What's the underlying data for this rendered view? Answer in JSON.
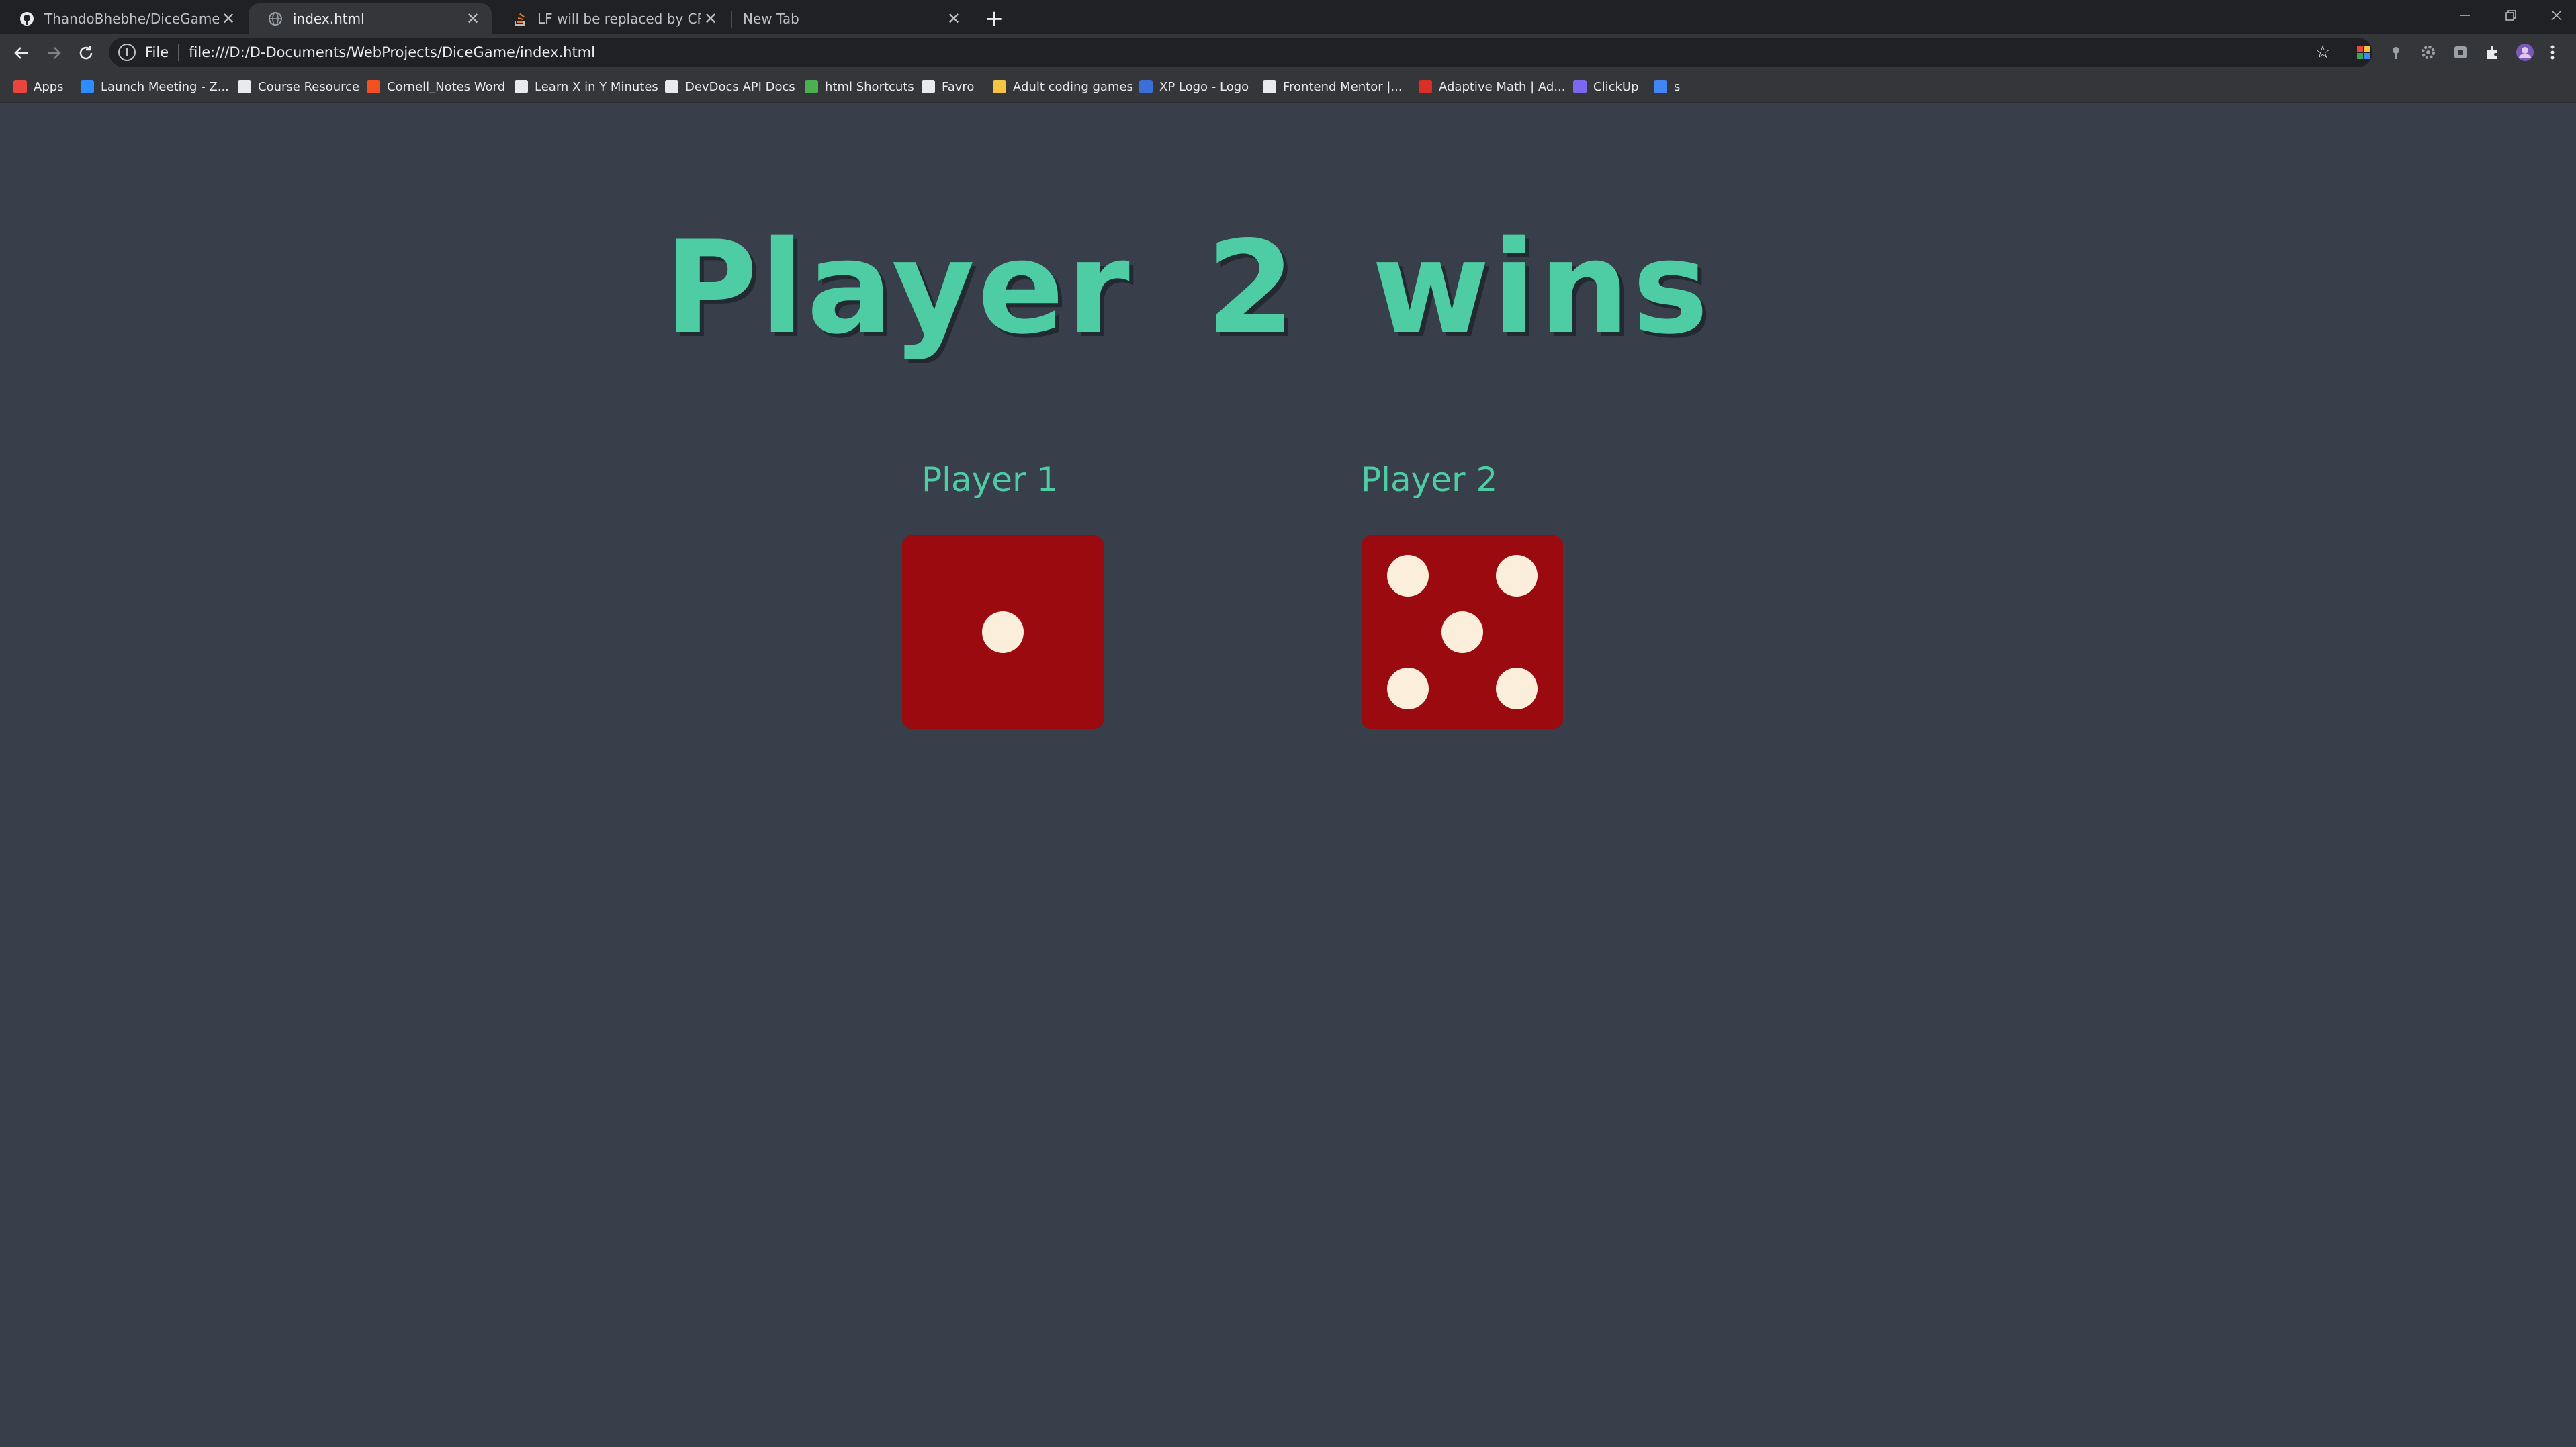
{
  "browser": {
    "tabs": [
      {
        "title": "ThandoBhebhe/DiceGame: Small",
        "favicon": "github-icon",
        "active": false
      },
      {
        "title": "index.html",
        "favicon": "globe-icon",
        "active": true
      },
      {
        "title": "LF will be replaced by CRLF in git",
        "favicon": "stackoverflow-icon",
        "active": false
      },
      {
        "title": "New Tab",
        "favicon": "",
        "active": false
      }
    ],
    "address": {
      "scheme_label": "File",
      "url": "file:///D:/D-Documents/WebProjects/DiceGame/index.html"
    },
    "bookmarks": [
      {
        "label": "Apps",
        "icon": "apps-grid-icon",
        "color": "#e8453c"
      },
      {
        "label": "Launch Meeting - Z...",
        "icon": "zoom-icon",
        "color": "#2d8cff"
      },
      {
        "label": "Course Resource",
        "icon": "course-icon",
        "color": "#e8eaed"
      },
      {
        "label": "Cornell_Notes Word",
        "icon": "microsoft-icon",
        "color": "#f25022"
      },
      {
        "label": "Learn X in Y Minutes",
        "icon": "x-icon",
        "color": "#e8eaed"
      },
      {
        "label": "DevDocs API Docs",
        "icon": "devdocs-icon",
        "color": "#e8eaed"
      },
      {
        "label": "html Shortcuts",
        "icon": "html-icon",
        "color": "#4caf50"
      },
      {
        "label": "Favro",
        "icon": "favro-icon",
        "color": "#e8eaed"
      },
      {
        "label": "Adult coding games",
        "icon": "folder-icon",
        "color": "#f4c542"
      },
      {
        "label": "XP Logo - Logo",
        "icon": "xp-logo-icon",
        "color": "#3b6fd8"
      },
      {
        "label": "Frontend Mentor |...",
        "icon": "frontend-mentor-icon",
        "color": "#e8eaed"
      },
      {
        "label": "Adaptive Math | Ad...",
        "icon": "adaptive-math-icon",
        "color": "#d93025"
      },
      {
        "label": "ClickUp",
        "icon": "clickup-icon",
        "color": "#7b68ee"
      },
      {
        "label": "s",
        "icon": "google-icon",
        "color": "#4285f4"
      }
    ]
  },
  "game": {
    "headline": "Player 2 wins",
    "players": [
      {
        "label": "Player 1",
        "die_value": 1
      },
      {
        "label": "Player 2",
        "die_value": 5
      }
    ]
  },
  "colors": {
    "background": "#393f4a",
    "accent": "#4ecca3",
    "die": "#9b0a0f",
    "pip": "#fbefdc"
  }
}
